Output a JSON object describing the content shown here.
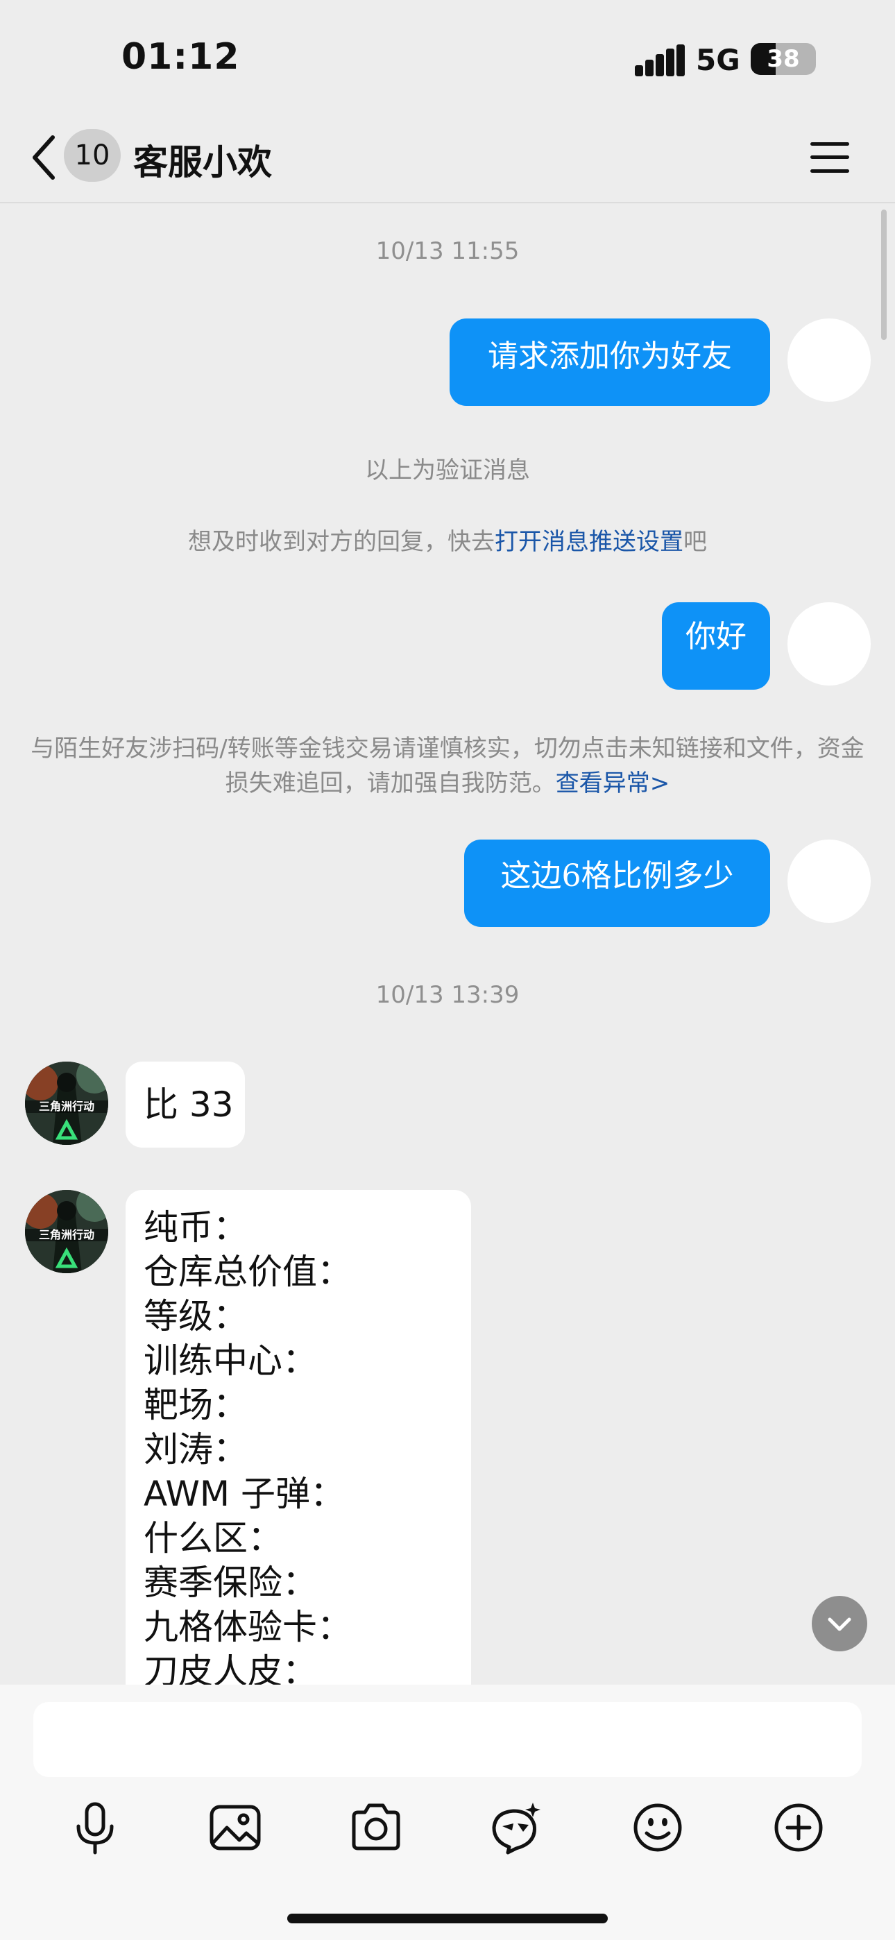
{
  "status_bar": {
    "time": "01:12",
    "network": "5G",
    "battery": "38",
    "battery_level": 0.38
  },
  "header": {
    "unread_count": "10",
    "title": "客服小欢"
  },
  "messages": {
    "time1": "10/13 11:55",
    "out1": "请求添加你为好友",
    "sys_verify": "以上为验证消息",
    "sys_push_prefix": "想及时收到对方的回复，快去",
    "sys_push_link": "打开消息推送设置",
    "sys_push_suffix": "吧",
    "out2": "你好",
    "sys_warn_text": "与陌生好友涉扫码/转账等金钱交易请谨慎核实，切勿点击未知链接和文件，资金损失难追回，请加强自我防范。",
    "sys_warn_link": "查看异常>",
    "out3": "这边6格比例多少",
    "time2": "10/13 13:39",
    "in1": "比 33",
    "in2_lines": [
      "纯币：",
      "仓库总价值：",
      "等级：",
      "训练中心：",
      "靶场：",
      "刘涛：",
      "AWM 子弹：",
      "什么区：",
      "赛季保险：",
      "九格体验卡：",
      "刀皮人皮："
    ],
    "avatar_text": "三角洲行动"
  },
  "toolbar": {
    "icons": [
      "microphone-icon",
      "image-icon",
      "camera-icon",
      "magic-face-icon",
      "emoji-icon",
      "plus-icon"
    ]
  },
  "colors": {
    "accent": "#0e92f7",
    "link": "#1a56a8",
    "background": "#ededed"
  }
}
